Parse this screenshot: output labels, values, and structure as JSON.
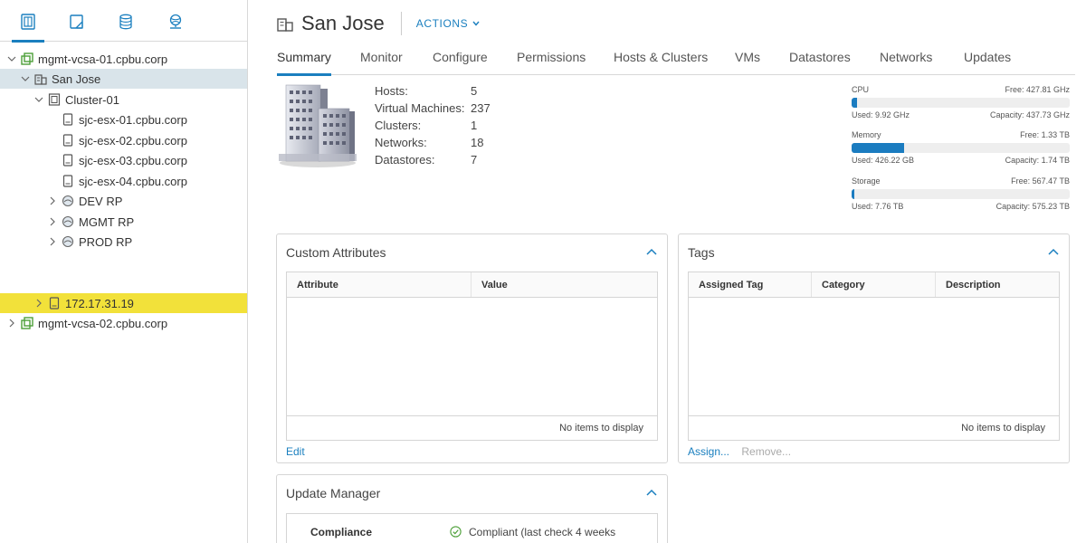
{
  "sidebar": {
    "tabs": [
      {
        "name": "hosts-clusters-icon",
        "active": true
      },
      {
        "name": "vms-templates-icon",
        "active": false
      },
      {
        "name": "storage-icon",
        "active": false
      },
      {
        "name": "networking-icon",
        "active": false
      }
    ],
    "tree": [
      {
        "label": "mgmt-vcsa-01.cpbu.corp",
        "icon": "vcenter-icon",
        "expand": "open"
      },
      {
        "label": "San Jose",
        "icon": "datacenter-icon",
        "expand": "open",
        "state": "selected"
      },
      {
        "label": "Cluster-01",
        "icon": "cluster-icon",
        "expand": "open"
      },
      {
        "label": "sjc-esx-01.cpbu.corp",
        "icon": "host-icon",
        "expand": "none"
      },
      {
        "label": "sjc-esx-02.cpbu.corp",
        "icon": "host-icon",
        "expand": "none"
      },
      {
        "label": "sjc-esx-03.cpbu.corp",
        "icon": "host-icon",
        "expand": "none"
      },
      {
        "label": "sjc-esx-04.cpbu.corp",
        "icon": "host-icon",
        "expand": "none"
      },
      {
        "label": "DEV RP",
        "icon": "resource-pool-icon",
        "expand": "closed"
      },
      {
        "label": "MGMT RP",
        "icon": "resource-pool-icon",
        "expand": "closed"
      },
      {
        "label": "PROD RP",
        "icon": "resource-pool-icon",
        "expand": "closed"
      },
      {
        "label": "172.17.31.19",
        "icon": "host-icon",
        "expand": "closed",
        "state": "highlight"
      },
      {
        "label": "mgmt-vcsa-02.cpbu.corp",
        "icon": "vcenter-icon",
        "expand": "closed"
      }
    ]
  },
  "header": {
    "title": "San Jose",
    "actions_label": "ACTIONS",
    "icon": "datacenter-icon"
  },
  "tabs": [
    "Summary",
    "Monitor",
    "Configure",
    "Permissions",
    "Hosts & Clusters",
    "VMs",
    "Datastores",
    "Networks",
    "Updates"
  ],
  "active_tab": "Summary",
  "summary": {
    "image": "datacenter-building-icon",
    "stats": [
      {
        "label": "Hosts:",
        "value": "5"
      },
      {
        "label": "Virtual Machines:",
        "value": "237"
      },
      {
        "label": "Clusters:",
        "value": "1"
      },
      {
        "label": "Networks:",
        "value": "18"
      },
      {
        "label": "Datastores:",
        "value": "7"
      }
    ]
  },
  "resources": [
    {
      "name": "CPU",
      "free": "Free: 427.81 GHz",
      "used": "Used: 9.92 GHz",
      "capacity": "Capacity: 437.73 GHz",
      "used_fraction": 0.023
    },
    {
      "name": "Memory",
      "free": "Free: 1.33 TB",
      "used": "Used: 426.22 GB",
      "capacity": "Capacity: 1.74 TB",
      "used_fraction": 0.24
    },
    {
      "name": "Storage",
      "free": "Free: 567.47 TB",
      "used": "Used: 7.76 TB",
      "capacity": "Capacity: 575.23 TB",
      "used_fraction": 0.013
    }
  ],
  "custom_attributes": {
    "title": "Custom Attributes",
    "columns": [
      "Attribute",
      "Value"
    ],
    "empty_text": "No items to display",
    "edit_label": "Edit"
  },
  "tags": {
    "title": "Tags",
    "columns": [
      "Assigned Tag",
      "Category",
      "Description"
    ],
    "empty_text": "No items to display",
    "assign_label": "Assign...",
    "remove_label": "Remove..."
  },
  "update_manager": {
    "title": "Update Manager",
    "compliance_label": "Compliance",
    "compliance_value": "Compliant (last check 4 weeks"
  },
  "colors": {
    "accent": "#1a7fbf",
    "selected_row": "#d9e4ea",
    "highlight_row": "#f2e13a",
    "vcenter_green": "#4c9f38",
    "bar_fill": "#1b7cc0"
  }
}
